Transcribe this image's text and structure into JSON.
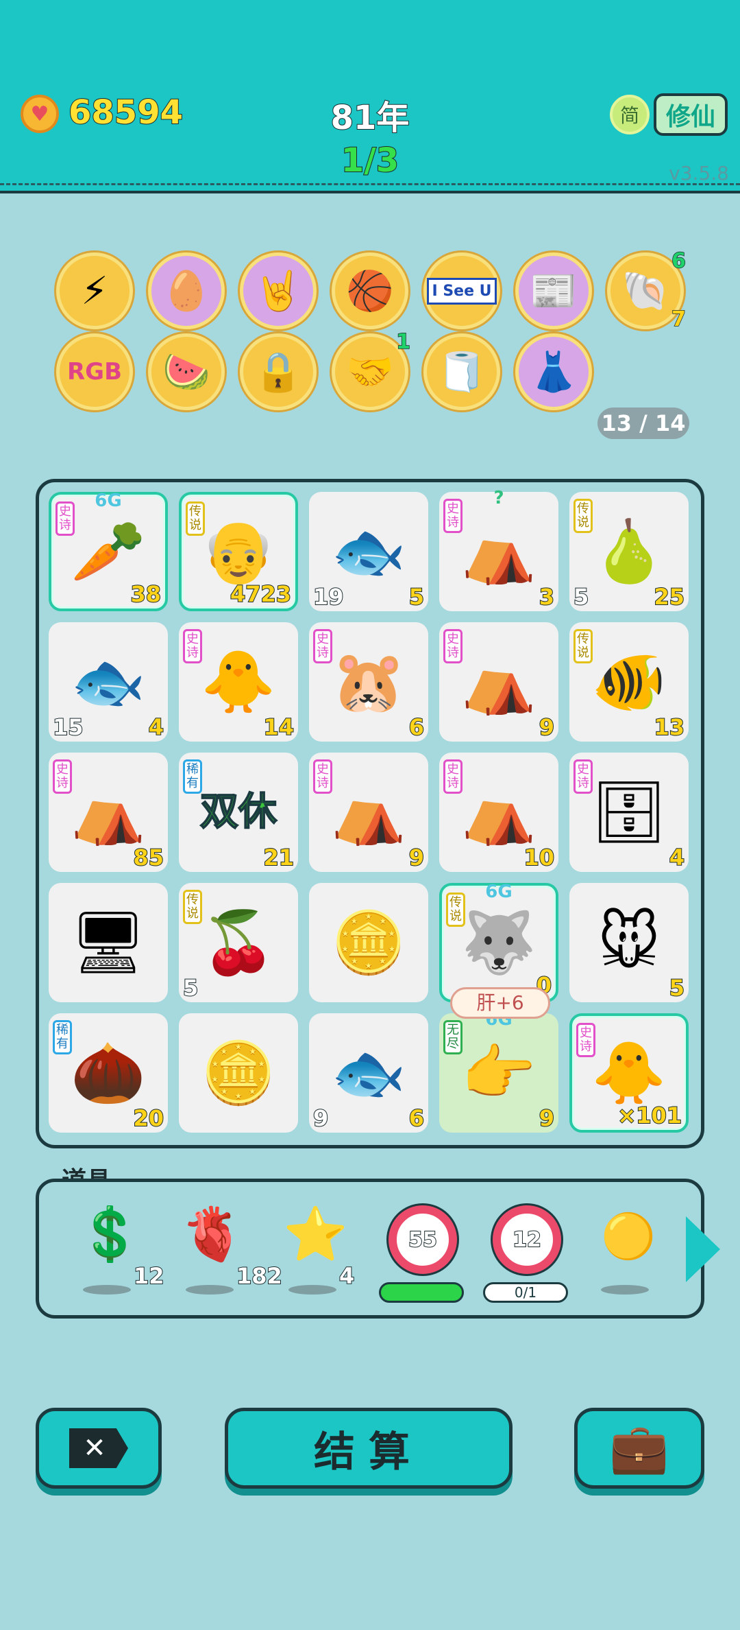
{
  "header": {
    "coins": "68594",
    "year": "81年",
    "round": "1/3",
    "lang_label": "简",
    "mode_label": "修仙",
    "version": "v3.5.8"
  },
  "relics": {
    "count_label": "13 / 14",
    "row1": [
      {
        "name": "lightning-icon",
        "glyph": "⚡",
        "style": "yellow"
      },
      {
        "name": "egg-icon",
        "glyph": "🥚",
        "style": "pink"
      },
      {
        "name": "rock-hand-icon",
        "glyph": "🤘",
        "style": "pink"
      },
      {
        "name": "basketballs-icon",
        "glyph": "🏀",
        "style": "yellow"
      },
      {
        "name": "i-see-u-sign-icon",
        "text": "I See U",
        "style": "yellow"
      },
      {
        "name": "time-magazine-icon",
        "glyph": "📰",
        "style": "pink"
      },
      {
        "name": "shell-icon",
        "glyph": "🐚",
        "style": "yellow",
        "badge_top": "6",
        "badge_bottom": "7"
      }
    ],
    "row2": [
      {
        "name": "rgb-icon",
        "text": "RGB",
        "style": "yellow"
      },
      {
        "name": "fruit-plate-icon",
        "glyph": "🍉",
        "style": "yellow"
      },
      {
        "name": "safe-icon",
        "glyph": "🔒",
        "style": "yellow"
      },
      {
        "name": "handshake-icon",
        "glyph": "🤝",
        "style": "yellow",
        "badge_top": "1"
      },
      {
        "name": "tissue-box-icon",
        "glyph": "🧻",
        "style": "yellow"
      },
      {
        "name": "skirt-icon",
        "glyph": "👗",
        "style": "pink"
      }
    ]
  },
  "board": {
    "cells": [
      {
        "name": "carrot",
        "glyph": "🥕",
        "tag": "史诗",
        "tagc": "epic",
        "top": "6G",
        "cnt": "38",
        "glow": true
      },
      {
        "name": "old-man-king",
        "glyph": "👴",
        "tag": "传说",
        "tagc": "legend",
        "cnt": "4723",
        "glow": true
      },
      {
        "name": "fish",
        "glyph": "🐟",
        "lcnt": "19",
        "cnt": "5"
      },
      {
        "name": "rabbit-tent",
        "glyph": "⛺",
        "tag": "史诗",
        "tagc": "epic",
        "top": "?",
        "cnt": "3"
      },
      {
        "name": "pear",
        "glyph": "🍐",
        "tag": "传说",
        "tagc": "legend",
        "lcnt": "5",
        "cnt": "25"
      },
      {
        "name": "fish",
        "glyph": "🐟",
        "lcnt": "15",
        "cnt": "4"
      },
      {
        "name": "chick-boy",
        "glyph": "🐥",
        "tag": "史诗",
        "tagc": "epic",
        "cnt": "14"
      },
      {
        "name": "gopher",
        "glyph": "🐹",
        "tag": "史诗",
        "tagc": "epic",
        "cnt": "6"
      },
      {
        "name": "rabbit-tent",
        "glyph": "⛺",
        "tag": "史诗",
        "tagc": "epic",
        "cnt": "9"
      },
      {
        "name": "koi-fish",
        "glyph": "🐠",
        "tag": "传说",
        "tagc": "legend",
        "cnt": "13"
      },
      {
        "name": "rabbit-tent",
        "glyph": "⛺",
        "tag": "史诗",
        "tagc": "epic",
        "cnt": "85"
      },
      {
        "name": "double-rest",
        "text": "双休",
        "tag": "稀有",
        "tagc": "rare",
        "cnt": "21"
      },
      {
        "name": "rabbit-tent-king",
        "glyph": "⛺",
        "tag": "史诗",
        "tagc": "epic",
        "cnt": "9"
      },
      {
        "name": "rabbit-tent-xi",
        "glyph": "⛺",
        "tag": "史诗",
        "tagc": "epic",
        "cnt": "10"
      },
      {
        "name": "server-rack",
        "glyph": "🗄",
        "tag": "史诗",
        "tagc": "epic",
        "cnt": "4"
      },
      {
        "name": "graphics-card",
        "glyph": "🖥"
      },
      {
        "name": "longan",
        "glyph": "🍒",
        "tag": "传说",
        "tagc": "legend",
        "lcnt": "5"
      },
      {
        "name": "coins-burst",
        "glyph": "🪙"
      },
      {
        "name": "husky-king",
        "glyph": "🐺",
        "tag": "传说",
        "tagc": "legend",
        "top": "6G",
        "cnt": "0",
        "glow": true
      },
      {
        "name": "mouse",
        "glyph": "🐭",
        "cnt": "5"
      },
      {
        "name": "chestnut",
        "glyph": "🌰",
        "tag": "稀有",
        "tagc": "rare",
        "cnt": "20"
      },
      {
        "name": "coins-pile",
        "glyph": "🪙"
      },
      {
        "name": "fish",
        "glyph": "🐟",
        "lcnt": "9",
        "cnt": "6"
      },
      {
        "name": "pointing-hand",
        "glyph": "👉",
        "tag": "无尽",
        "tagc": "unique",
        "top": "6G",
        "cnt": "9",
        "green": true
      },
      {
        "name": "chick-boy-king",
        "glyph": "🐥",
        "tag": "史诗",
        "tagc": "epic",
        "cnt": "×101",
        "glow": true
      }
    ],
    "popup": "肝+6"
  },
  "items": {
    "title": "道具",
    "list": [
      {
        "name": "dollar-coin",
        "glyph": "💲",
        "count": "12"
      },
      {
        "name": "liver",
        "glyph": "🫀",
        "count": "182"
      },
      {
        "name": "star",
        "glyph": "⭐",
        "count": "4"
      }
    ],
    "ring1": {
      "value": "55",
      "bar": "",
      "fill": 1.0
    },
    "ring2": {
      "value": "12",
      "bar": "0/1",
      "fill": 0.0
    },
    "orb": "🟡"
  },
  "buttons": {
    "close": "✕",
    "settle": "结算",
    "bag": "💼"
  }
}
